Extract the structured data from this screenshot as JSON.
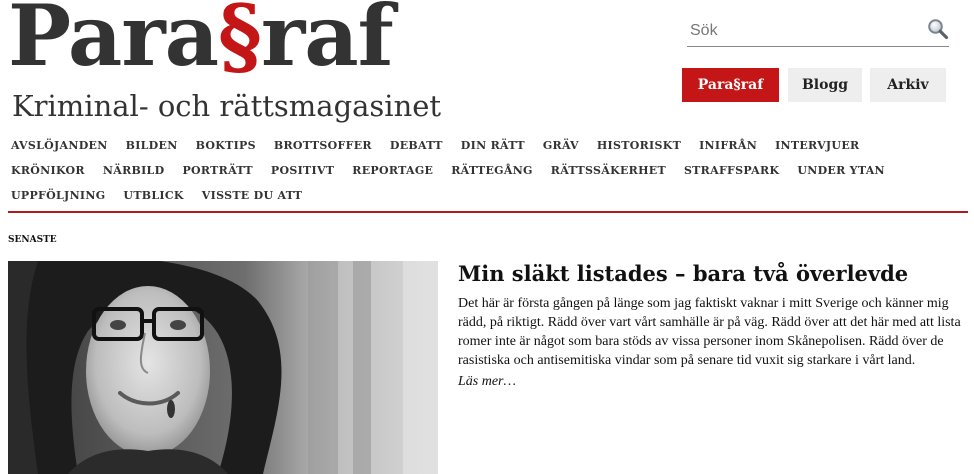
{
  "header": {
    "logo_text": "Para§raf",
    "tagline": "Kriminal- och rättsmagasinet"
  },
  "search": {
    "placeholder": "Sök",
    "icon": "search-icon"
  },
  "top_buttons": {
    "paragraf_label": "Para§raf",
    "blogg_label": "Blogg",
    "arkiv_label": "Arkiv"
  },
  "colors": {
    "accent": "#c41616",
    "button_bg": "#eeeeee",
    "divider": "#b01a1a"
  },
  "nav": {
    "items": [
      "AVSLÖJANDEN",
      "BILDEN",
      "BOKTIPS",
      "BROTTSOFFER",
      "DEBATT",
      "DIN RÄTT",
      "GRÄV",
      "HISTORISKT",
      "INIFRÅN",
      "INTERVJUER",
      "KRÖNIKOR",
      "NÄRBILD",
      "PORTRÄTT",
      "POSITIVT",
      "REPORTAGE",
      "RÄTTEGÅNG",
      "RÄTTSSÄKERHET",
      "STRAFFSPARK",
      "UNDER YTAN",
      "UPPFÖLJNING",
      "UTBLICK",
      "VISSTE DU ATT"
    ]
  },
  "latest": {
    "section_label": "SENASTE",
    "title": "Min släkt listades – bara två överlevde",
    "excerpt": "Det här är första gången på länge som jag faktiskt vaknar i mitt Sverige och känner mig rädd, på riktigt. Rädd över vart vårt samhälle är på väg. Rädd över att det här med att lista romer inte är något som bara stöds av vissa personer inom Skånepolisen. Rädd över de rasistiska och antisemitiska vindar som på senare tid vuxit sig starkare i vårt land.",
    "read_more": "Läs mer…"
  }
}
